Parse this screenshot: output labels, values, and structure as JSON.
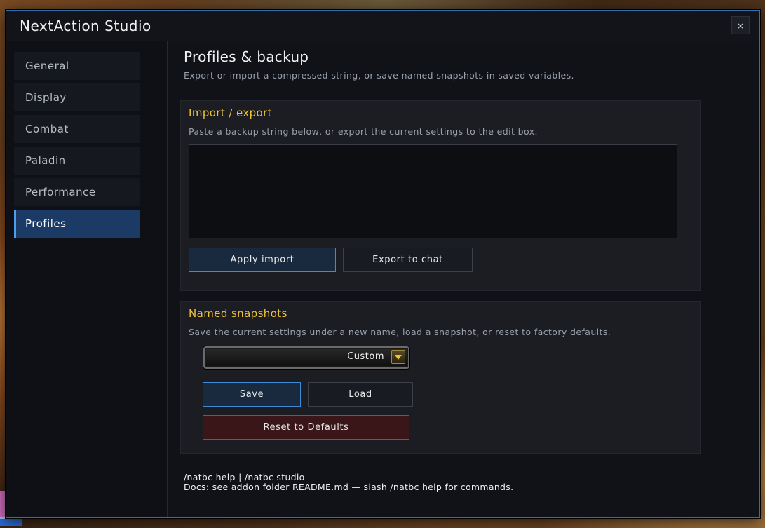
{
  "window": {
    "title": "NextAction Studio",
    "close_label": "×"
  },
  "sidebar": {
    "items": [
      {
        "label": "General"
      },
      {
        "label": "Display"
      },
      {
        "label": "Combat"
      },
      {
        "label": "Paladin"
      },
      {
        "label": "Performance"
      },
      {
        "label": "Profiles",
        "active": true
      }
    ]
  },
  "main": {
    "title": "Profiles & backup",
    "subtitle": "Export or import a compressed string, or save named snapshots in saved variables."
  },
  "import_export": {
    "title": "Import / export",
    "description": "Paste a backup string below, or export the current settings to the edit box.",
    "edit_value": "",
    "apply_label": "Apply import",
    "export_label": "Export to chat"
  },
  "snapshots": {
    "title": "Named snapshots",
    "description": "Save the current settings under a new name, load a snapshot, or reset to factory defaults.",
    "selected": "Custom",
    "save_label": "Save",
    "load_label": "Load",
    "reset_label": "Reset to Defaults"
  },
  "footer": {
    "line1": "/natbc help | /natbc studio",
    "line2": "Docs: see addon folder README.md — slash /natbc help for commands."
  },
  "colors": {
    "accent": "#4aa0f0",
    "section_title": "#f0c23a",
    "danger": "#b03c3c"
  }
}
